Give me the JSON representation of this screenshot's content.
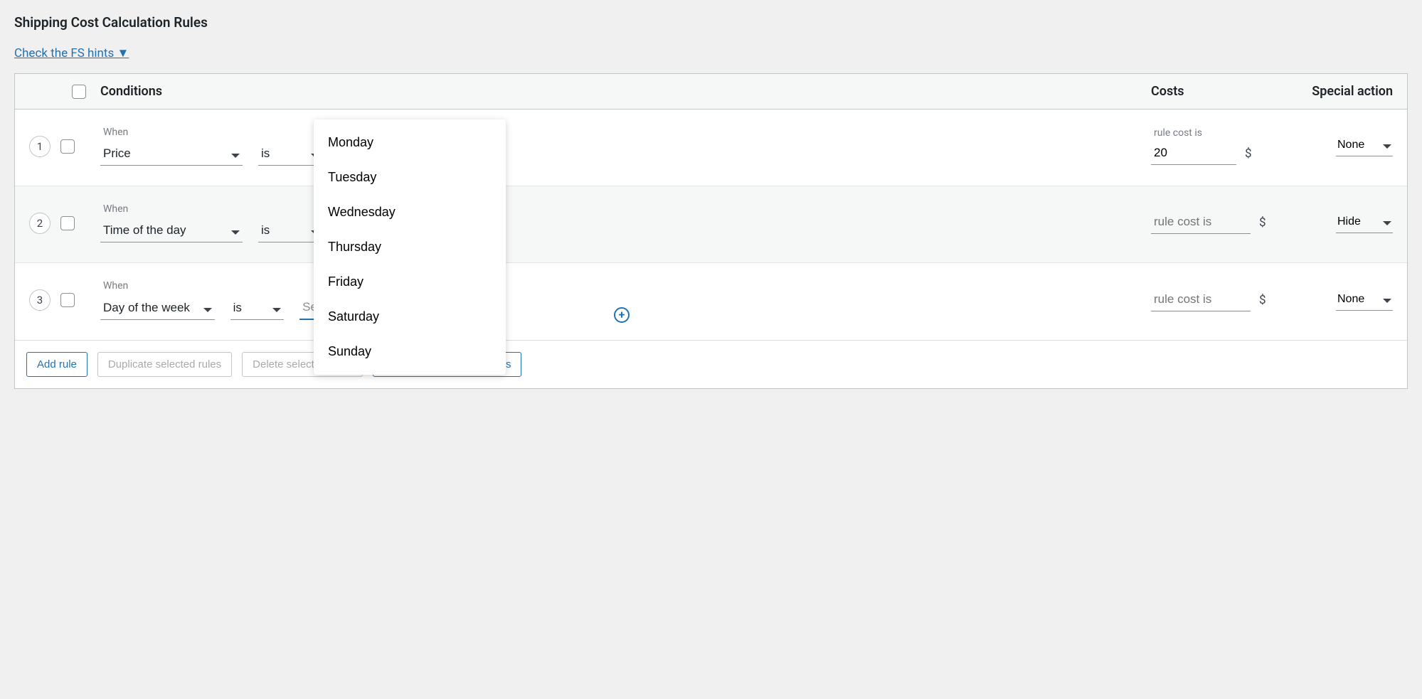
{
  "title": "Shipping Cost Calculation Rules",
  "hints_link": "Check the FS hints ▼",
  "columns": {
    "conditions": "Conditions",
    "costs": "Costs",
    "special": "Special action"
  },
  "when_label": "When",
  "cost_label": "rule cost is",
  "currency": "$",
  "rules": [
    {
      "n": "1",
      "cond": "Price",
      "op": "is",
      "cost": "20",
      "special": "None"
    },
    {
      "n": "2",
      "cond": "Time of the day",
      "op": "is",
      "cost": "",
      "special": "Hide"
    },
    {
      "n": "3",
      "cond": "Day of the week",
      "op": "is",
      "cost": "",
      "special": "None"
    }
  ],
  "multiselect_placeholder": "Select the days",
  "dropdown_options": [
    "Monday",
    "Tuesday",
    "Wednesday",
    "Thursday",
    "Friday",
    "Saturday",
    "Sunday"
  ],
  "buttons": {
    "add": "Add rule",
    "dup": "Duplicate selected rules",
    "del": "Delete selected rules",
    "ready": "Use ready-made scenarios"
  }
}
